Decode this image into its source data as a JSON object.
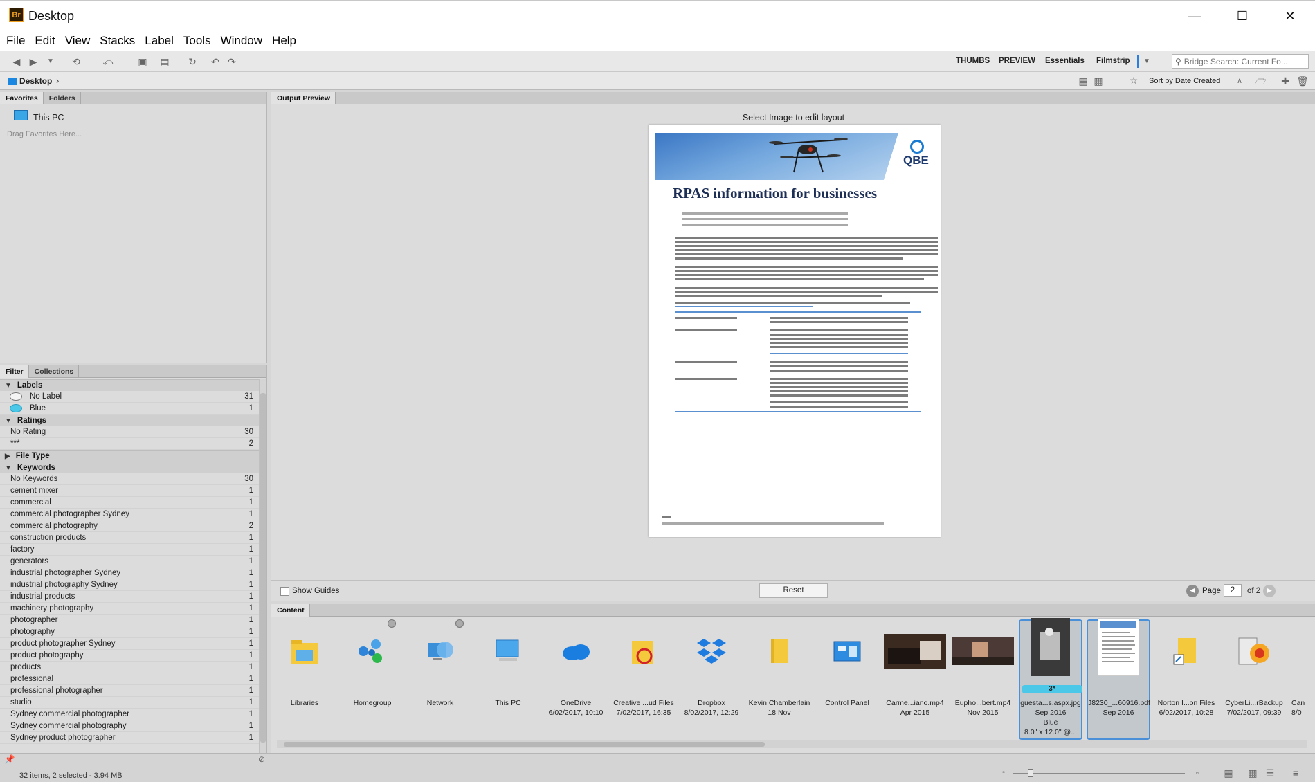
{
  "window": {
    "title": "Desktop",
    "app_icon": "Br"
  },
  "menu": [
    "File",
    "Edit",
    "View",
    "Stacks",
    "Label",
    "Tools",
    "Window",
    "Help"
  ],
  "workspaces": [
    "THUMBS",
    "PREVIEW",
    "Essentials",
    "Filmstrip"
  ],
  "search": {
    "placeholder": "Bridge Search: Current Fo..."
  },
  "path": {
    "current": "Desktop"
  },
  "sort": {
    "label": "Sort by Date Created"
  },
  "favorites_panel": {
    "tabs": [
      "Favorites",
      "Folders"
    ],
    "items": [
      "This PC"
    ],
    "drag_hint": "Drag Favorites Here..."
  },
  "filter_panel": {
    "tabs": [
      "Filter",
      "Collections"
    ],
    "groups": {
      "labels": {
        "title": "Labels",
        "rows": [
          {
            "name": "No Label",
            "count": "31"
          },
          {
            "name": "Blue",
            "count": "1"
          }
        ]
      },
      "ratings": {
        "title": "Ratings",
        "rows": [
          {
            "name": "No Rating",
            "count": "30"
          },
          {
            "name": "***",
            "count": "2"
          }
        ]
      },
      "file_type": {
        "title": "File Type"
      },
      "keywords": {
        "title": "Keywords",
        "rows": [
          {
            "name": "No Keywords",
            "count": "30"
          },
          {
            "name": "cement mixer",
            "count": "1"
          },
          {
            "name": "commercial",
            "count": "1"
          },
          {
            "name": "commercial photographer Sydney",
            "count": "1"
          },
          {
            "name": "commercial photography",
            "count": "2"
          },
          {
            "name": "construction products",
            "count": "1"
          },
          {
            "name": "factory",
            "count": "1"
          },
          {
            "name": "generators",
            "count": "1"
          },
          {
            "name": "industrial photographer Sydney",
            "count": "1"
          },
          {
            "name": "industrial photography Sydney",
            "count": "1"
          },
          {
            "name": "industrial products",
            "count": "1"
          },
          {
            "name": "machinery photography",
            "count": "1"
          },
          {
            "name": "photographer",
            "count": "1"
          },
          {
            "name": "photography",
            "count": "1"
          },
          {
            "name": "product photographer Sydney",
            "count": "1"
          },
          {
            "name": "product photography",
            "count": "1"
          },
          {
            "name": "products",
            "count": "1"
          },
          {
            "name": "professional",
            "count": "1"
          },
          {
            "name": "professional photographer",
            "count": "1"
          },
          {
            "name": "studio",
            "count": "1"
          },
          {
            "name": "Sydney commercial photographer",
            "count": "1"
          },
          {
            "name": "Sydney commercial photography",
            "count": "1"
          },
          {
            "name": "Sydney product photographer",
            "count": "1"
          }
        ]
      }
    }
  },
  "preview": {
    "tab": "Output Preview",
    "hint": "Select Image to edit layout",
    "document_title": "RPAS information for businesses",
    "logo_text": "QBE",
    "show_guides_label": "Show Guides",
    "reset_label": "Reset",
    "page_label": "Page",
    "page_value": "2",
    "page_of": "of 2"
  },
  "content": {
    "tab": "Content",
    "items": [
      {
        "name": "Libraries",
        "meta": ""
      },
      {
        "name": "Homegroup",
        "meta": ""
      },
      {
        "name": "Network",
        "meta": ""
      },
      {
        "name": "This PC",
        "meta": ""
      },
      {
        "name": "OneDrive",
        "meta": "6/02/2017, 10:10"
      },
      {
        "name": "Creative ...ud Files",
        "meta": "7/02/2017, 16:35"
      },
      {
        "name": "Dropbox",
        "meta": "8/02/2017, 12:29"
      },
      {
        "name": "Kevin Chamberlain",
        "meta": "18 Nov"
      },
      {
        "name": "Control Panel",
        "meta": ""
      },
      {
        "name": "Carme...iano.mp4",
        "meta": "Apr 2015"
      },
      {
        "name": "Eupho...bert.mp4",
        "meta": "Nov 2015"
      },
      {
        "name": "guesta...s.aspx.jpg",
        "meta": "Sep 2016",
        "label": "Blue",
        "size": "8.0\" x 12.0\" @...",
        "rating": "3*"
      },
      {
        "name": "J8230_...60916.pdf",
        "meta": "Sep 2016"
      },
      {
        "name": "Norton I...on Files",
        "meta": "6/02/2017, 10:28"
      },
      {
        "name": "CyberLi...rBackup",
        "meta": "7/02/2017, 09:39"
      },
      {
        "name": "Can",
        "meta": "8/0"
      }
    ]
  },
  "status": {
    "text": "32 items, 2 selected - 3.94 MB"
  },
  "colors": {
    "accent": "#4a90d9",
    "label_blue": "#4bc8e8",
    "panel": "#dcdcdc"
  }
}
